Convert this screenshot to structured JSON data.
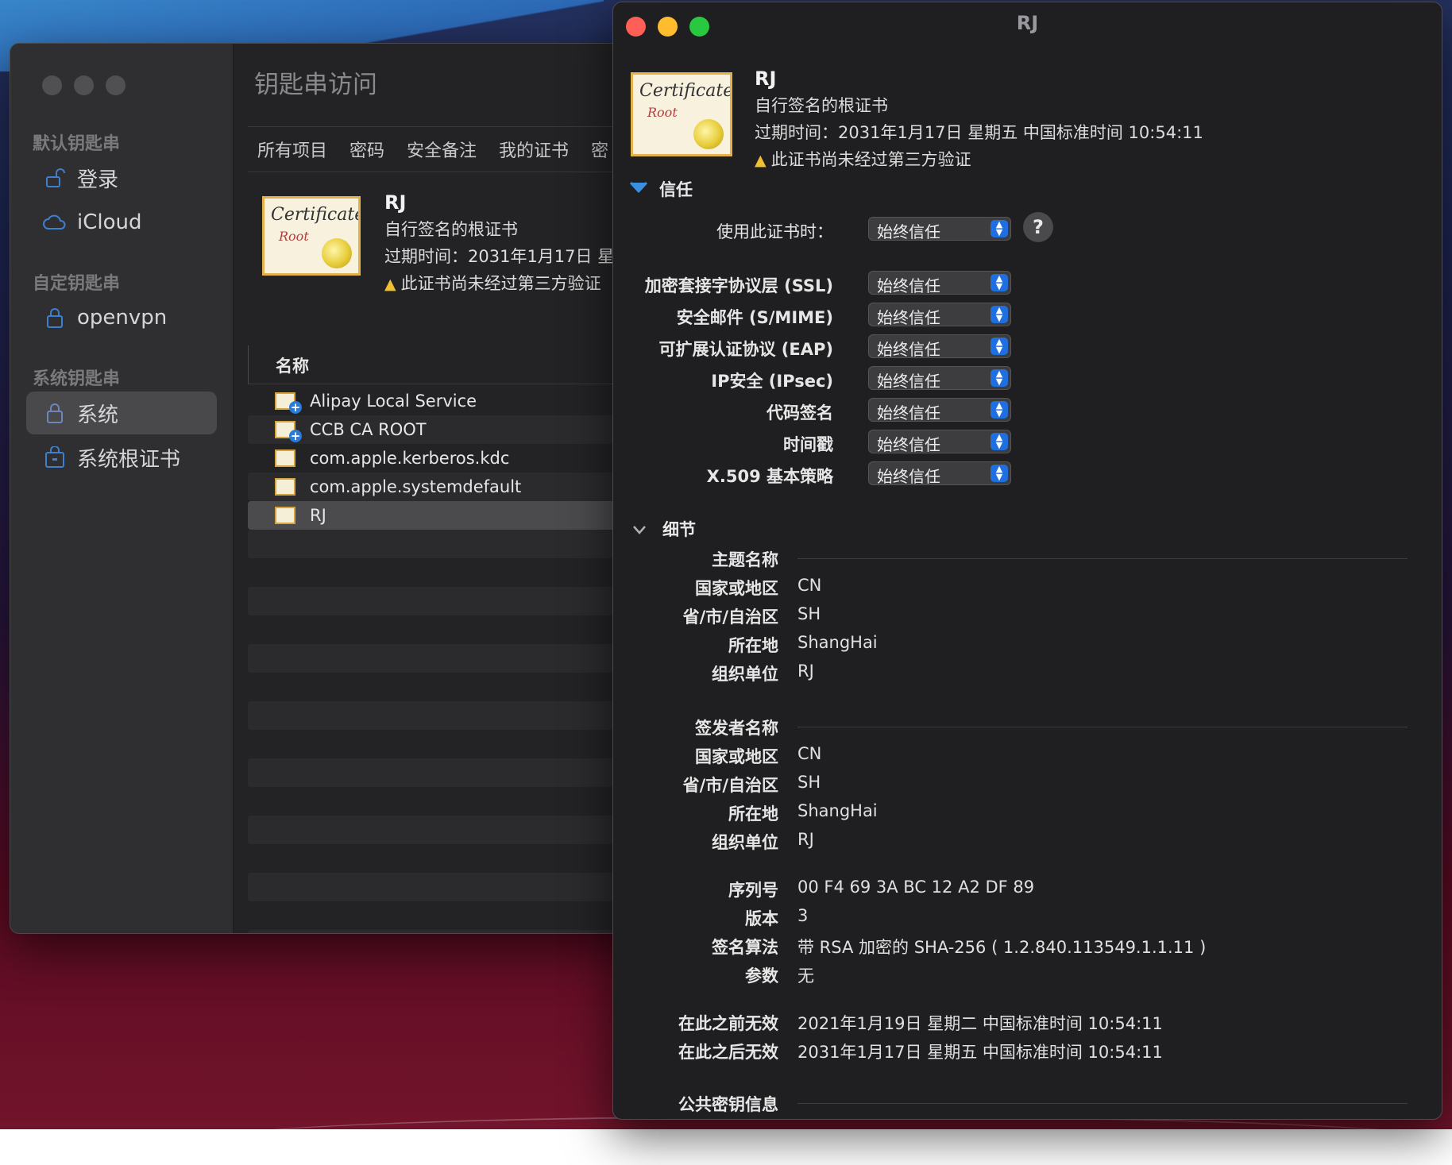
{
  "main_window": {
    "title": "钥匙串访问",
    "sidebar": {
      "sections": [
        {
          "label": "默认钥匙串",
          "items": [
            {
              "label": "登录",
              "icon": "unlock-icon"
            },
            {
              "label": "iCloud",
              "icon": "cloud-icon"
            }
          ]
        },
        {
          "label": "自定钥匙串",
          "items": [
            {
              "label": "openvpn",
              "icon": "lock-icon"
            }
          ]
        },
        {
          "label": "系统钥匙串",
          "items": [
            {
              "label": "系统",
              "icon": "lock-icon",
              "selected": true
            },
            {
              "label": "系统根证书",
              "icon": "cabinet-icon"
            }
          ]
        }
      ]
    },
    "tabs": [
      "所有项目",
      "密码",
      "安全备注",
      "我的证书",
      "密"
    ],
    "cert_summary": {
      "name": "RJ",
      "type": "自行签名的根证书",
      "expiry": "过期时间：2031年1月17日 星",
      "warning": "此证书尚未经过第三方验证"
    },
    "list": {
      "column": "名称",
      "rows": [
        {
          "name": "Alipay Local Service",
          "icon": "cert-plus-icon"
        },
        {
          "name": "CCB CA ROOT",
          "icon": "cert-plus-icon"
        },
        {
          "name": "com.apple.kerberos.kdc",
          "icon": "cert-icon"
        },
        {
          "name": "com.apple.systemdefault",
          "icon": "cert-icon"
        },
        {
          "name": "RJ",
          "icon": "cert-icon",
          "selected": true
        }
      ]
    }
  },
  "detail_window": {
    "title": "RJ",
    "cert": {
      "name": "RJ",
      "type": "自行签名的根证书",
      "expiry": "过期时间：2031年1月17日 星期五 中国标准时间 10:54:11",
      "warning": "此证书尚未经过第三方验证"
    },
    "trust": {
      "header": "信任",
      "use_label": "使用此证书时：",
      "use_value": "始终信任",
      "help": "?",
      "policies": [
        {
          "label": "加密套接字协议层 (SSL)",
          "value": "始终信任"
        },
        {
          "label": "安全邮件 (S/MIME)",
          "value": "始终信任"
        },
        {
          "label": "可扩展认证协议 (EAP)",
          "value": "始终信任"
        },
        {
          "label": "IP安全 (IPsec)",
          "value": "始终信任"
        },
        {
          "label": "代码签名",
          "value": "始终信任"
        },
        {
          "label": "时间戳",
          "value": "始终信任"
        },
        {
          "label": "X.509 基本策略",
          "value": "始终信任"
        }
      ]
    },
    "details": {
      "header": "细节",
      "subject": {
        "title": "主题名称",
        "fields": [
          {
            "k": "国家或地区",
            "v": "CN"
          },
          {
            "k": "省/市/自治区",
            "v": "SH"
          },
          {
            "k": "所在地",
            "v": "ShangHai"
          },
          {
            "k": "组织单位",
            "v": "RJ"
          }
        ]
      },
      "issuer": {
        "title": "签发者名称",
        "fields": [
          {
            "k": "国家或地区",
            "v": "CN"
          },
          {
            "k": "省/市/自治区",
            "v": "SH"
          },
          {
            "k": "所在地",
            "v": "ShangHai"
          },
          {
            "k": "组织单位",
            "v": "RJ"
          }
        ]
      },
      "misc": [
        {
          "k": "序列号",
          "v": "00 F4 69 3A BC 12 A2 DF 89"
        },
        {
          "k": "版本",
          "v": "3"
        },
        {
          "k": "签名算法",
          "v": "带 RSA 加密的 SHA-256 ( 1.2.840.113549.1.1.11 )"
        },
        {
          "k": "参数",
          "v": "无"
        }
      ],
      "validity": [
        {
          "k": "在此之前无效",
          "v": "2021年1月19日 星期二 中国标准时间 10:54:11"
        },
        {
          "k": "在此之后无效",
          "v": "2031年1月17日 星期五 中国标准时间 10:54:11"
        }
      ],
      "public_key_title": "公共密钥信息"
    }
  },
  "colors": {
    "accent": "#1f6fe0",
    "warning": "#f0c030",
    "close": "#fe5f57",
    "minimize": "#febc2e",
    "zoom": "#28c840"
  }
}
